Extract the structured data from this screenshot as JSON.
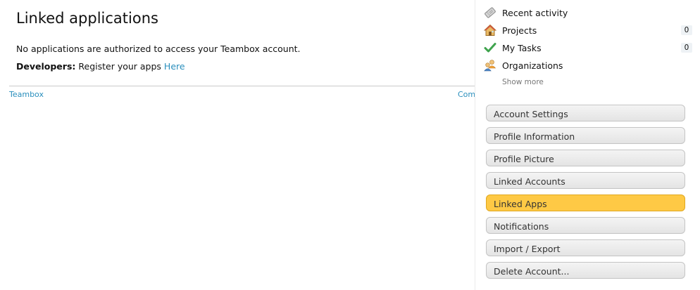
{
  "main": {
    "title": "Linked applications",
    "message": "No applications are authorized to access your Teambox account.",
    "developers_label": "Developers:",
    "developers_text": "Register your apps",
    "developers_link": "Here"
  },
  "footer": {
    "left_link": "Teambox",
    "right_link": "Com"
  },
  "sidebar": {
    "nav": [
      {
        "label": "Recent activity",
        "icon": "ticket-icon"
      },
      {
        "label": "Projects",
        "icon": "house-icon",
        "count": "0"
      },
      {
        "label": "My Tasks",
        "icon": "checkmark-icon",
        "count": "0"
      },
      {
        "label": "Organizations",
        "icon": "people-icon"
      }
    ],
    "show_more": "Show more",
    "settings": [
      {
        "label": "Account Settings"
      },
      {
        "label": "Profile Information"
      },
      {
        "label": "Profile Picture"
      },
      {
        "label": "Linked Accounts"
      },
      {
        "label": "Linked Apps",
        "active": true
      },
      {
        "label": "Notifications"
      },
      {
        "label": "Import / Export"
      },
      {
        "label": "Delete Account..."
      }
    ]
  },
  "colors": {
    "accent": "#fec945",
    "link": "#2a8fbd"
  }
}
